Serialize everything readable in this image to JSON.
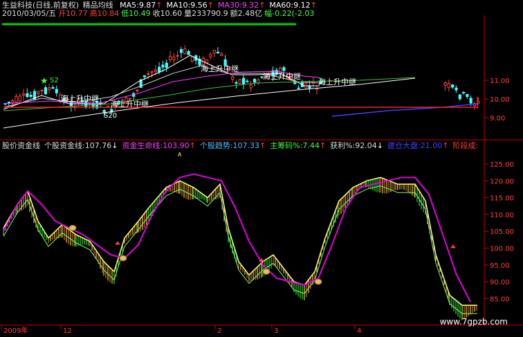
{
  "header": {
    "security": "生益科技(日线,前复权)",
    "indicator": "精品均线",
    "ma": [
      {
        "label": "MA5:9.87",
        "color": "#ffffff"
      },
      {
        "label": "MA10:9.56",
        "color": "#ffffff"
      },
      {
        "label": "MA30:9.32",
        "color": "#ff40ff"
      },
      {
        "label": "MA60:9.12",
        "color": "#ffffff"
      }
    ],
    "arrow": "↑",
    "quote": [
      {
        "label": "2010/03/05/五",
        "color": "#dddddd"
      },
      {
        "label": "开10.77",
        "color": "#ff4040"
      },
      {
        "label": "高10.84",
        "color": "#ff4040"
      },
      {
        "label": "低10.49",
        "color": "#40ff40"
      },
      {
        "label": "收10.60",
        "color": "#dddddd"
      },
      {
        "label": "量233790.9",
        "color": "#dddddd"
      },
      {
        "label": "额2.48亿",
        "color": "#dddddd"
      },
      {
        "label": "幅-0.22(-2.03",
        "color": "#40ff40"
      }
    ]
  },
  "price_axis": [
    "11.00",
    "10.00",
    "9.00"
  ],
  "annotations": {
    "s2": "S2",
    "s20": "S20",
    "tag": "海上升中继",
    "small_arrow": "∧"
  },
  "indicator_header": [
    {
      "label": "股价资金线",
      "color": "#dddddd"
    },
    {
      "label": "个股资金线:107.76",
      "color": "#dddddd",
      "arrow": "↓",
      "arrow_color": "#ffffff"
    },
    {
      "label": "资金生命线:103.90",
      "color": "#ff40ff",
      "arrow": "↑",
      "arrow_color": "#ff4040"
    },
    {
      "label": "个股趋势:107.33",
      "color": "#40c0ff",
      "arrow": "↑",
      "arrow_color": "#ff4040"
    },
    {
      "label": "主筹码%:7.44",
      "color": "#40ff40",
      "arrow": "↑",
      "arrow_color": "#ff4040"
    },
    {
      "label": "获利%:92.04",
      "color": "#dddddd",
      "arrow": "↓",
      "arrow_color": "#ffffff"
    },
    {
      "label": "建仓大盘:21.00",
      "color": "#4040ff",
      "arrow": "↑",
      "arrow_color": "#ff4040"
    },
    {
      "label": "阶段成:",
      "color": "#ff4040"
    }
  ],
  "indicator_axis": [
    "125.00",
    "120.00",
    "115.00",
    "110.00",
    "105.00",
    "100.00",
    "95.00",
    "90.00",
    "85.00"
  ],
  "time_axis": [
    "2009年",
    "12",
    "2",
    "3",
    "4"
  ],
  "watermark": "www.7gpzb.com",
  "colors": {
    "up": "#ff4040",
    "down": "#40ffff",
    "ma_white": "#ffffff",
    "ma_magenta": "#ff40ff",
    "ma_blue": "#4040ff",
    "resistance": "#ff2020",
    "fund_line": "#ffff80",
    "life_line": "#e000e0",
    "axis": "#c00000",
    "separator": "#00d000"
  },
  "icons": [
    "star-icon",
    "coin-marker-icon",
    "up-arrow-icon"
  ]
}
